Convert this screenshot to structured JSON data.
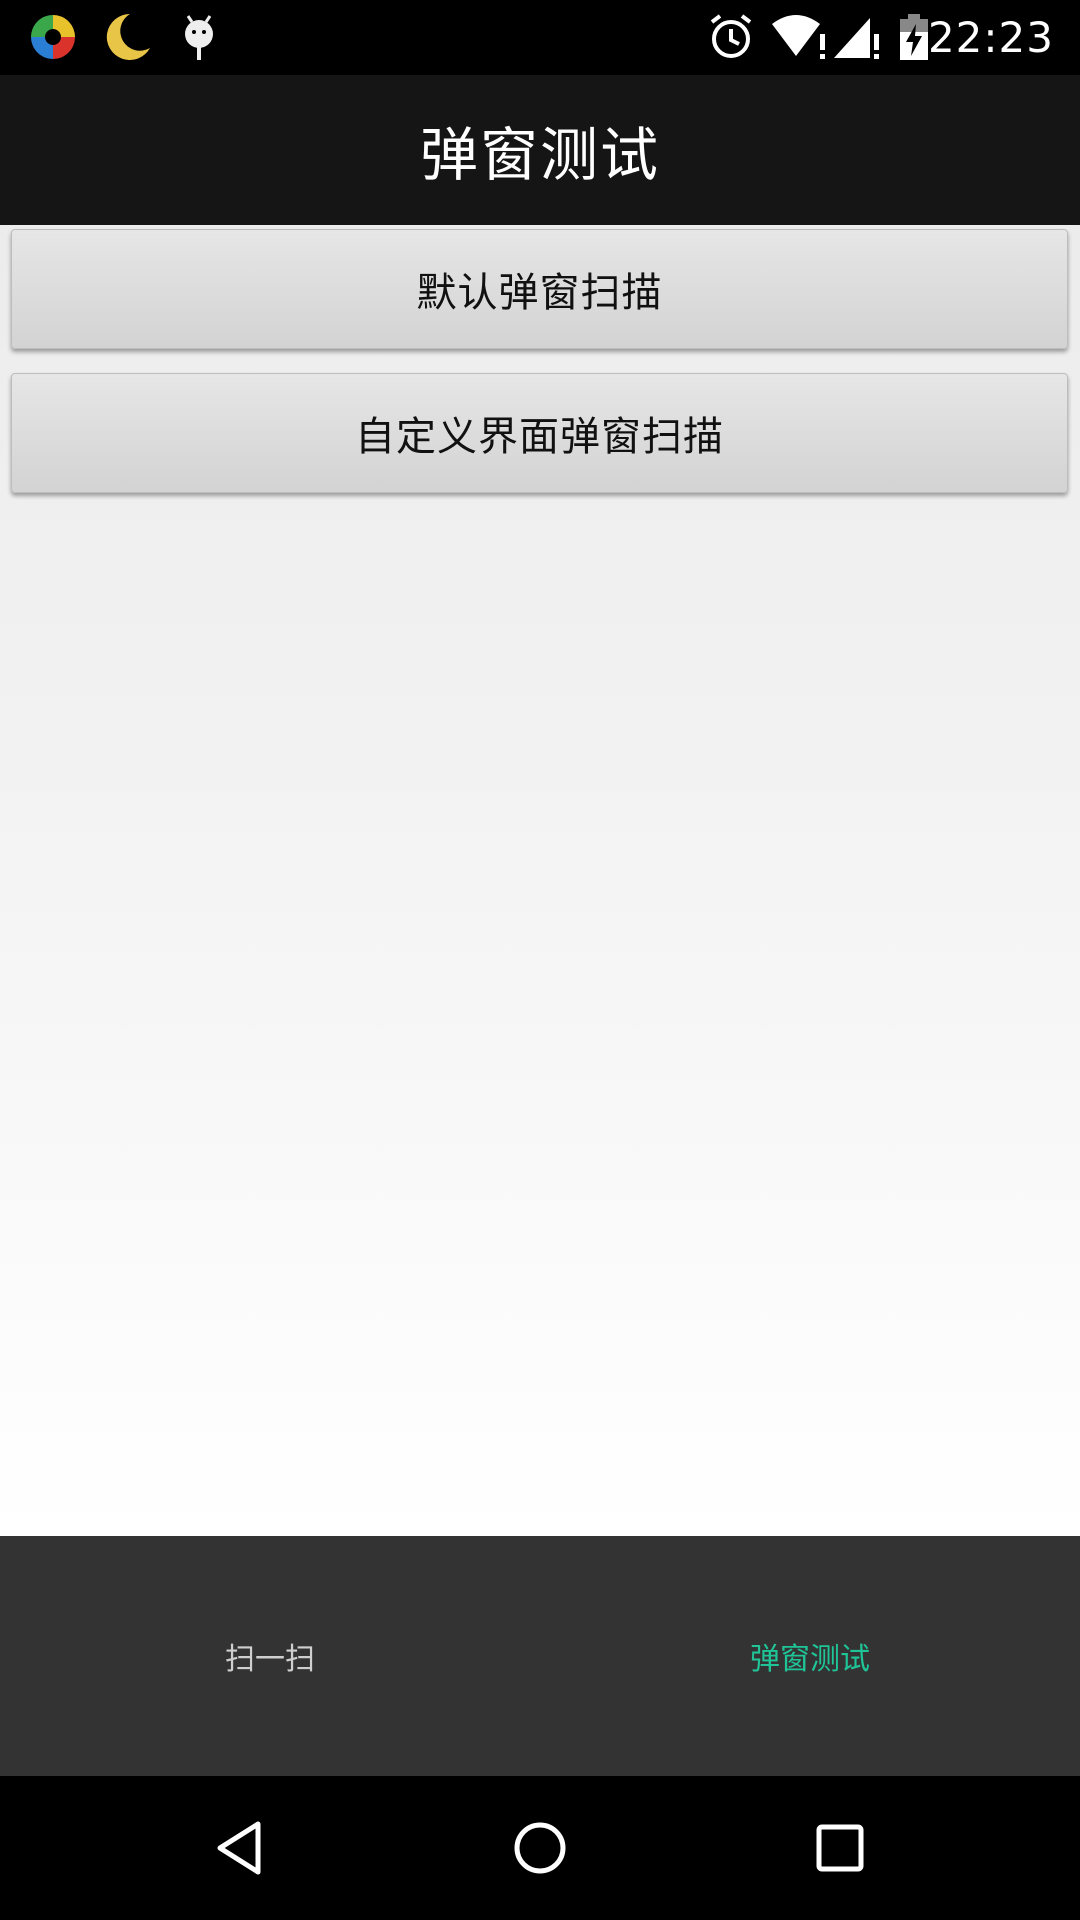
{
  "status_bar": {
    "time": "22:23",
    "icons": [
      "app-icon",
      "moon-icon",
      "android-icon",
      "alarm-icon",
      "wifi-icon",
      "signal-icon",
      "battery-icon"
    ]
  },
  "app_bar": {
    "title": "弹窗测试"
  },
  "buttons": {
    "default_popup_scan": "默认弹窗扫描",
    "custom_popup_scan": "自定义界面弹窗扫描"
  },
  "tabs": [
    {
      "label": "扫一扫",
      "selected": false
    },
    {
      "label": "弹窗测试",
      "selected": true
    }
  ],
  "colors": {
    "accent": "#1fc497",
    "tab_bar_bg": "#333333",
    "app_bar_bg": "#151515"
  },
  "nav_bar": {
    "icons": [
      "back-icon",
      "home-icon",
      "recent-apps-icon"
    ]
  }
}
